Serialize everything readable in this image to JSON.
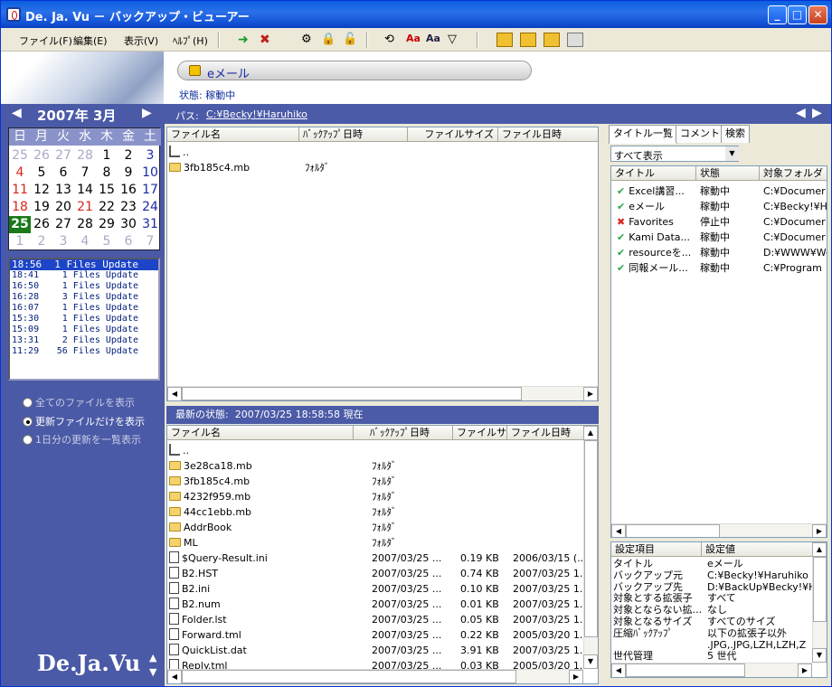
{
  "window": {
    "title": "De. Ja. Vu － バックアップ・ビューアー"
  },
  "menu": [
    "ファイル(F)",
    "編集(E)",
    "表示(V)",
    "ﾍﾙﾌﾟ(H)"
  ],
  "header": {
    "current_title": "eメール",
    "status_label": "状態:",
    "status_value": "稼動中"
  },
  "path": {
    "label": "パス:",
    "value": "C:¥Becky!¥Haruhiko"
  },
  "calendar": {
    "year_month": "2007年 3月",
    "weekdays": [
      "日",
      "月",
      "火",
      "水",
      "木",
      "金",
      "土"
    ],
    "weeks": [
      [
        "25",
        "26",
        "27",
        "28",
        "1",
        "2",
        "3"
      ],
      [
        "4",
        "5",
        "6",
        "7",
        "8",
        "9",
        "10"
      ],
      [
        "11",
        "12",
        "13",
        "14",
        "15",
        "16",
        "17"
      ],
      [
        "18",
        "19",
        "20",
        "21",
        "22",
        "23",
        "24"
      ],
      [
        "25",
        "26",
        "27",
        "28",
        "29",
        "30",
        "31"
      ],
      [
        "1",
        "2",
        "3",
        "4",
        "5",
        "6",
        "7"
      ]
    ],
    "selected": "25",
    "colors": {
      "sun": "#d8261f",
      "sat": "#1a2aa8",
      "other": "#a9a9c8",
      "selected_bg": "#1a7a1a"
    }
  },
  "log": [
    {
      "time": "18:56",
      "text": "1 Files Update"
    },
    {
      "time": "18:41",
      "text": "1 Files Update"
    },
    {
      "time": "16:50",
      "text": "1 Files Update"
    },
    {
      "time": "16:28",
      "text": "3 Files Update"
    },
    {
      "time": "16:07",
      "text": "1 Files Update"
    },
    {
      "time": "15:30",
      "text": "1 Files Update"
    },
    {
      "time": "15:09",
      "text": "1 Files Update"
    },
    {
      "time": "13:31",
      "text": "2 Files Update"
    },
    {
      "time": "11:29",
      "text": "56 Files Update"
    }
  ],
  "radios": [
    {
      "label": "全てのファイルを表示",
      "checked": false
    },
    {
      "label": "更新ファイルだけを表示",
      "checked": true
    },
    {
      "label": "1日分の更新を一覧表示",
      "checked": false
    }
  ],
  "brand": "De.Ja.Vu",
  "upper_pane": {
    "columns": [
      "ファイル名",
      "ﾊﾞｯｸｱｯﾌﾟ日時",
      "ファイルサイズ",
      "ファイル日時"
    ],
    "rows": [
      {
        "name": "..",
        "type": "up",
        "date": "",
        "size": "",
        "fdate": ""
      },
      {
        "name": "3fb185c4.mb",
        "type": "folder",
        "date": "ﾌｫﾙﾀﾞ",
        "size": "",
        "fdate": ""
      }
    ]
  },
  "latest": {
    "label": "最新の状態:",
    "value": "2007/03/25 18:58:58 現在"
  },
  "lower_pane": {
    "columns": [
      "ファイル名",
      "ﾊﾞｯｸｱｯﾌﾟ日時",
      "ファイルサ...",
      "ファイル日時"
    ],
    "rows": [
      {
        "name": "..",
        "type": "up",
        "date": "",
        "size": "",
        "fdate": ""
      },
      {
        "name": "3e28ca18.mb",
        "type": "folder",
        "date": "ﾌｫﾙﾀﾞ",
        "size": "",
        "fdate": ""
      },
      {
        "name": "3fb185c4.mb",
        "type": "folder",
        "date": "ﾌｫﾙﾀﾞ",
        "size": "",
        "fdate": ""
      },
      {
        "name": "4232f959.mb",
        "type": "folder",
        "date": "ﾌｫﾙﾀﾞ",
        "size": "",
        "fdate": ""
      },
      {
        "name": "44cc1ebb.mb",
        "type": "folder",
        "date": "ﾌｫﾙﾀﾞ",
        "size": "",
        "fdate": ""
      },
      {
        "name": "AddrBook",
        "type": "folder",
        "date": "ﾌｫﾙﾀﾞ",
        "size": "",
        "fdate": ""
      },
      {
        "name": "ML",
        "type": "folder",
        "date": "ﾌｫﾙﾀﾞ",
        "size": "",
        "fdate": ""
      },
      {
        "name": "$Query-Result.ini",
        "type": "file",
        "date": "2007/03/25 ...",
        "size": "0.19 KB",
        "fdate": "2006/03/15 (..."
      },
      {
        "name": "B2.HST",
        "type": "file",
        "date": "2007/03/25 ...",
        "size": "0.74 KB",
        "fdate": "2007/03/25 1..."
      },
      {
        "name": "B2.ini",
        "type": "file",
        "date": "2007/03/25 ...",
        "size": "0.10 KB",
        "fdate": "2007/03/25 1..."
      },
      {
        "name": "B2.num",
        "type": "file",
        "date": "2007/03/25 ...",
        "size": "0.01 KB",
        "fdate": "2007/03/25 1..."
      },
      {
        "name": "Folder.lst",
        "type": "file",
        "date": "2007/03/25 ...",
        "size": "0.05 KB",
        "fdate": "2007/03/25 1..."
      },
      {
        "name": "Forward.tml",
        "type": "file",
        "date": "2007/03/25 ...",
        "size": "0.22 KB",
        "fdate": "2005/03/20 1..."
      },
      {
        "name": "QuickList.dat",
        "type": "file",
        "date": "2007/03/25 ...",
        "size": "3.91 KB",
        "fdate": "2007/03/25 1..."
      },
      {
        "name": "Reply.tml",
        "type": "file",
        "date": "2007/03/25 ...",
        "size": "0.03 KB",
        "fdate": "2005/03/20 1..."
      }
    ]
  },
  "right": {
    "tabs": [
      "タイトル一覧",
      "コメント",
      "検索"
    ],
    "filter": "すべて表示",
    "columns": [
      "タイトル",
      "状態",
      "対象フォルダ"
    ],
    "rows": [
      {
        "title": "Excel講習...",
        "status": "稼動中",
        "folder": "C:¥Documer",
        "ok": true
      },
      {
        "title": "eメール",
        "status": "稼動中",
        "folder": "C:¥Becky!¥H",
        "ok": true
      },
      {
        "title": "Favorites",
        "status": "停止中",
        "folder": "C:¥Documer",
        "ok": false
      },
      {
        "title": "Kami Data...",
        "status": "稼動中",
        "folder": "C:¥Documer",
        "ok": true
      },
      {
        "title": "resourceを...",
        "status": "稼動中",
        "folder": "D:¥WWW¥We",
        "ok": true
      },
      {
        "title": "同報メール...",
        "status": "稼動中",
        "folder": "C:¥Program",
        "ok": true
      }
    ],
    "settings_columns": [
      "設定項目",
      "設定値"
    ],
    "settings": [
      {
        "k": "タイトル",
        "v": "eメール"
      },
      {
        "k": "バックアップ元",
        "v": "C:¥Becky!¥Haruhiko"
      },
      {
        "k": "バックアップ先",
        "v": "D:¥BackUp¥Becky!¥Ha"
      },
      {
        "k": "対象とする拡張子",
        "v": "すべて"
      },
      {
        "k": "対象とならない拡...",
        "v": "なし"
      },
      {
        "k": "対象となるサイズ",
        "v": "すべてのサイズ"
      },
      {
        "k": "圧縮ﾊﾞｯｸｱｯﾌﾟ",
        "v": "以下の拡張子以外"
      },
      {
        "k": "",
        "v": ".JPG,.JPG,LZH,LZH,Z"
      },
      {
        "k": "世代管理",
        "v": "5 世代"
      }
    ]
  }
}
